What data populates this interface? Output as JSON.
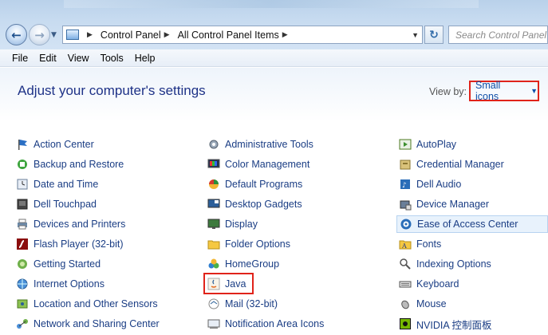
{
  "window": {
    "breadcrumb": [
      "Control Panel",
      "All Control Panel Items"
    ],
    "search_placeholder": "Search Control Panel"
  },
  "menu": [
    "File",
    "Edit",
    "View",
    "Tools",
    "Help"
  ],
  "header": {
    "title": "Adjust your computer's settings",
    "view_by_label": "View by:",
    "view_by_value": "Small icons"
  },
  "items": {
    "col1": [
      {
        "label": "Action Center",
        "icon": "flag-icon"
      },
      {
        "label": "Backup and Restore",
        "icon": "backup-icon"
      },
      {
        "label": "Date and Time",
        "icon": "clock-icon"
      },
      {
        "label": "Dell Touchpad",
        "icon": "touchpad-icon"
      },
      {
        "label": "Devices and Printers",
        "icon": "printer-icon"
      },
      {
        "label": "Flash Player (32-bit)",
        "icon": "flash-icon"
      },
      {
        "label": "Getting Started",
        "icon": "getting-started-icon"
      },
      {
        "label": "Internet Options",
        "icon": "globe-icon"
      },
      {
        "label": "Location and Other Sensors",
        "icon": "sensor-icon"
      },
      {
        "label": "Network and Sharing Center",
        "icon": "network-icon"
      }
    ],
    "col2": [
      {
        "label": "Administrative Tools",
        "icon": "admin-tools-icon"
      },
      {
        "label": "Color Management",
        "icon": "color-icon"
      },
      {
        "label": "Default Programs",
        "icon": "default-programs-icon"
      },
      {
        "label": "Desktop Gadgets",
        "icon": "gadgets-icon"
      },
      {
        "label": "Display",
        "icon": "display-icon"
      },
      {
        "label": "Folder Options",
        "icon": "folder-icon"
      },
      {
        "label": "HomeGroup",
        "icon": "homegroup-icon"
      },
      {
        "label": "Java",
        "icon": "java-icon"
      },
      {
        "label": "Mail (32-bit)",
        "icon": "mail-icon"
      },
      {
        "label": "Notification Area Icons",
        "icon": "notification-icon"
      }
    ],
    "col3": [
      {
        "label": "AutoPlay",
        "icon": "autoplay-icon"
      },
      {
        "label": "Credential Manager",
        "icon": "credential-icon"
      },
      {
        "label": "Dell Audio",
        "icon": "audio-icon"
      },
      {
        "label": "Device Manager",
        "icon": "device-manager-icon"
      },
      {
        "label": "Ease of Access Center",
        "icon": "ease-of-access-icon"
      },
      {
        "label": "Fonts",
        "icon": "fonts-icon"
      },
      {
        "label": "Indexing Options",
        "icon": "indexing-icon"
      },
      {
        "label": "Keyboard",
        "icon": "keyboard-icon"
      },
      {
        "label": "Mouse",
        "icon": "mouse-icon"
      },
      {
        "label": "NVIDIA 控制面板",
        "icon": "nvidia-icon"
      }
    ]
  },
  "colors": {
    "link": "#1a3d84",
    "title": "#1e3287",
    "highlight_border": "#e0231a"
  }
}
